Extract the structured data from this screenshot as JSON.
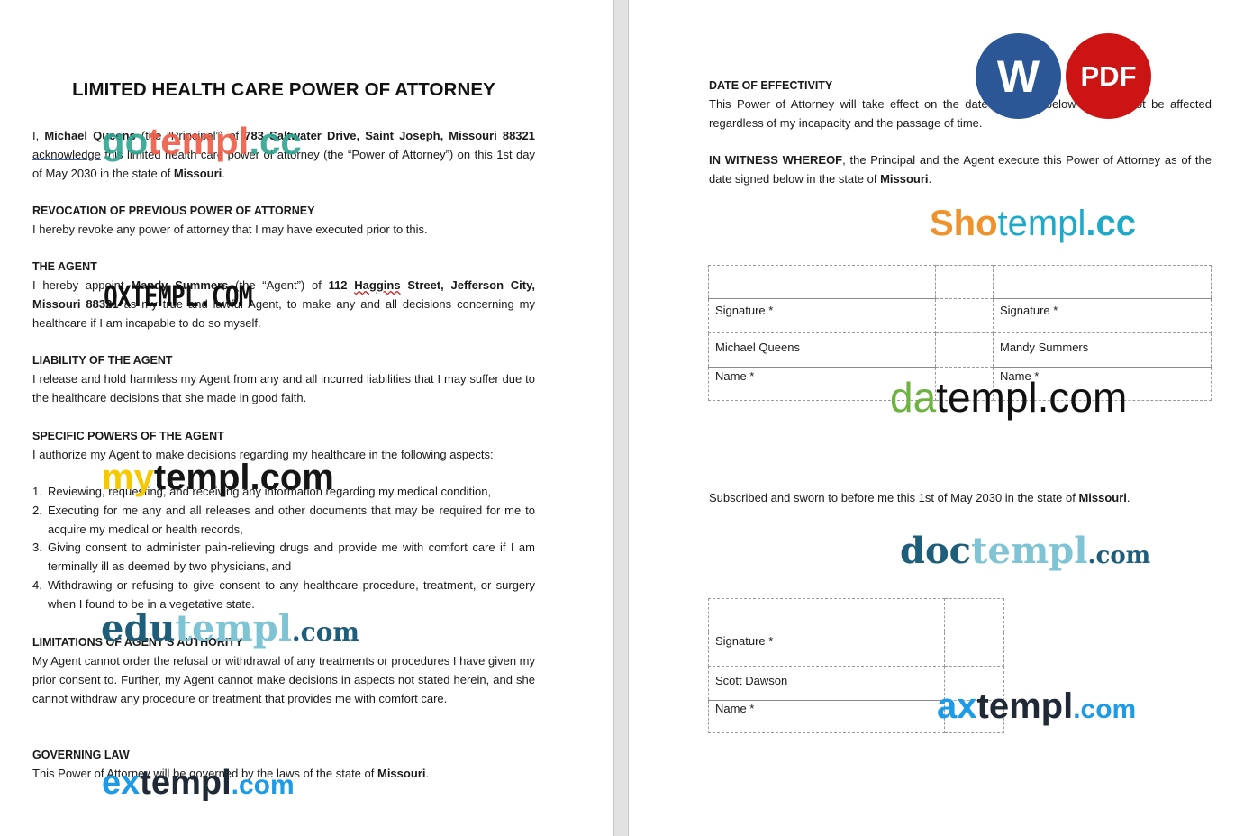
{
  "document": {
    "title": "LIMITED HEALTH CARE POWER OF ATTORNEY",
    "intro": {
      "p1": "I, ",
      "principal_name": "Michael Queens",
      "p2": " (the “Principal”) of ",
      "principal_address": "783 Saltwater Drive, Saint Joseph, Missouri 88321",
      "acknowledge": "acknowledge",
      "p3": " this limited health care power of attorney (the “Power of Attorney”) on this 1st day of May 2030 in the state of ",
      "state": "Missouri",
      "end": "."
    },
    "sections": {
      "revocation": {
        "heading": "REVOCATION OF PREVIOUS POWER OF ATTORNEY",
        "body": "I hereby revoke any power of attorney that I may have executed prior to this."
      },
      "agent": {
        "heading": "THE AGENT",
        "p1": "I hereby appoint ",
        "agent_name": "Mandy Summers",
        "p2": " (the “Agent”) of ",
        "agent_address_a": "112 ",
        "agent_address_b": "Haggins",
        "agent_address_c": " Street, Jefferson City, Missouri 88321",
        "p3": " as my true and lawful Agent, to make any and all decisions concerning my healthcare if I am incapable to do so myself."
      },
      "liability": {
        "heading": "LIABILITY OF THE AGENT",
        "body": "I release and hold harmless my Agent from any and all incurred liabilities that I may suffer due to the healthcare decisions that she made in good faith."
      },
      "powers": {
        "heading": "SPECIFIC POWERS OF THE AGENT",
        "body": "I authorize my Agent to make decisions regarding my healthcare in the following aspects:",
        "items": [
          {
            "num": "1.",
            "text": "Reviewing, requesting, and receiving any information regarding my medical condition,"
          },
          {
            "num": "2.",
            "text": "Executing for me any and all releases and other documents that may be required for me to acquire my medical or health records,"
          },
          {
            "num": "3.",
            "text": "Giving consent to administer pain-relieving drugs and provide me with comfort care if I am terminally ill as deemed by two physicians, and"
          },
          {
            "num": "4.",
            "text": "Withdrawing or refusing to give consent to any healthcare procedure, treatment, or surgery when I found to be in a vegetative state."
          }
        ]
      },
      "limitations": {
        "heading": "LIMITATIONS OF AGENT’S AUTHORITY",
        "body": "My Agent cannot order the refusal or withdrawal of any treatments or procedures I have given my prior consent to. Further, my Agent cannot make decisions in aspects not stated herein, and she cannot withdraw any procedure or treatment that provides me with comfort care."
      },
      "governing": {
        "heading": "GOVERNING LAW",
        "body": "This Power of Attorney will be governed by the laws of the state of ",
        "state": "Missouri",
        "end": "."
      },
      "effectivity": {
        "heading": "DATE OF EFFECTIVITY",
        "body": "This Power of Attorney will take effect on the date specified below and will not be affected regardless of my incapacity and the passage of time."
      },
      "witness": {
        "lead": "IN WITNESS WHEREOF",
        "body": ", the Principal and the Agent execute this Power of Attorney as of the date signed below in the state of ",
        "state": "Missouri",
        "end": "."
      },
      "notary": {
        "body": "Subscribed and sworn to before me this 1st of May 2030 in the state of ",
        "state": "Missouri",
        "end": "."
      }
    },
    "signature_table_1": {
      "left": {
        "signature_label": "Signature *",
        "name_value": "Michael Queens",
        "name_label": "Name *"
      },
      "right": {
        "signature_label": "Signature *",
        "name_value": "Mandy Summers",
        "name_label": "Name *"
      }
    },
    "signature_table_2": {
      "signature_label": "Signature *",
      "name_value": "Scott Dawson",
      "name_label": "Name *"
    }
  },
  "badges": {
    "word": {
      "label": "W",
      "color": "#2b5797"
    },
    "pdf": {
      "label": "PDF",
      "color": "#cc1414"
    }
  },
  "watermarks": {
    "gotempl": {
      "a": "go",
      "b": "templ",
      "c": ".cc"
    },
    "oxtempl": {
      "text": "OXTEMPL.COM"
    },
    "mytempl": {
      "a": "my",
      "b": "templ.com"
    },
    "edutempl": {
      "a": "edu",
      "b": "templ",
      "c": ".com"
    },
    "extempl": {
      "a": "ex",
      "b": "templ",
      "c": ".com"
    },
    "shotempl": {
      "a": "Sho",
      "b": "templ",
      "c": ".cc"
    },
    "datempl": {
      "a": "da",
      "b": "templ.com"
    },
    "doctempl": {
      "a": "doc",
      "b": "templ",
      "c": ".com"
    },
    "axtempl": {
      "a": "ax",
      "b": "templ",
      "c": ".com"
    }
  }
}
